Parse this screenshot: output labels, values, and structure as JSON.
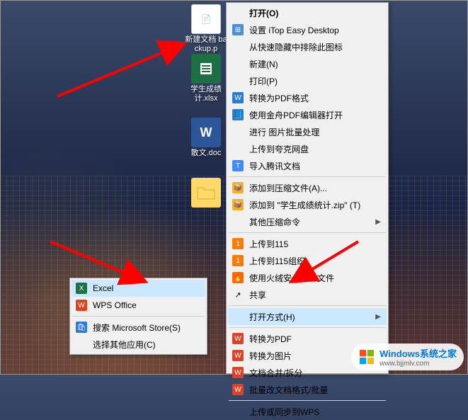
{
  "desktop_icons": {
    "icon1": {
      "label": "新建文档\nbackup.p"
    },
    "icon2": {
      "label": "学生成绩\n计.xlsx"
    },
    "icon3": {
      "label": "散文.doc"
    },
    "icon4": {
      "label": ""
    }
  },
  "main_menu": {
    "open": "打开(O)",
    "itop": "设置 iTop Easy Desktop",
    "exclude": "从快速隐藏中排除此图标",
    "new": "新建(N)",
    "print": "打印(P)",
    "convert_pdf": "转换为PDF格式",
    "jinzhou": "使用金舟PDF编辑器打开",
    "batch_image": "进行 图片批量处理",
    "upload_kuake": "上传到夸克网盘",
    "import_tencent": "导入腾讯文档",
    "add_archive": "添加到压缩文件(A)...",
    "add_zip": "添加到 \"学生成绩统计.zip\" (T)",
    "other_compress": "其他压缩命令",
    "upload_115": "上传到115",
    "upload_115_org": "上传到115组织",
    "huorong_shred": "使用火绒安全粉碎文件",
    "share": "共享",
    "open_with": "打开方式(H)",
    "convert_pdf2": "转换为PDF",
    "convert_image": "转换为图片",
    "doc_merge": "文档合并/拆分",
    "batch_rename": "批量改文档格式/批量",
    "upload_wps": "上传或同步到WPS"
  },
  "submenu": {
    "excel": "Excel",
    "wps": "WPS Office",
    "search_store": "搜索 Microsoft Store(S)",
    "choose_other": "选择其他应用(C)"
  },
  "watermark": {
    "text": "Windows系统之家",
    "url": "www.bjjmlv.com"
  }
}
